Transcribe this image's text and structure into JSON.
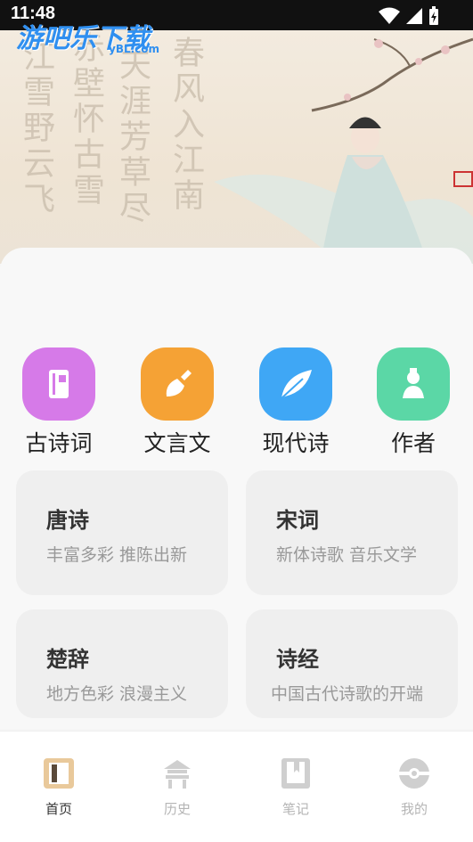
{
  "status_bar": {
    "time": "11:48"
  },
  "watermark": {
    "brand": "游吧乐下载",
    "site": "yBL.com"
  },
  "hero": {
    "callig_cols": [
      "江雪野云飞",
      "赤壁怀古雪",
      "天涯芳草尽",
      "春风入江南"
    ]
  },
  "categories": [
    {
      "label": "古诗词",
      "icon": "notebook-icon",
      "color": "#d67ae8"
    },
    {
      "label": "文言文",
      "icon": "brush-icon",
      "color": "#f5a235"
    },
    {
      "label": "现代诗",
      "icon": "feather-icon",
      "color": "#3fa7f5"
    },
    {
      "label": "作者",
      "icon": "author-icon",
      "color": "#5bd7a6"
    }
  ],
  "cards": [
    {
      "title": "唐诗",
      "sub": "丰富多彩 推陈出新"
    },
    {
      "title": "宋词",
      "sub": "新体诗歌 音乐文学"
    },
    {
      "title": "楚辞",
      "sub": "地方色彩 浪漫主义"
    },
    {
      "title": "诗经",
      "sub": "中国古代诗歌的开端"
    }
  ],
  "nav": [
    {
      "label": "首页",
      "icon": "home-book-icon",
      "active": true
    },
    {
      "label": "历史",
      "icon": "pavilion-icon",
      "active": false
    },
    {
      "label": "笔记",
      "icon": "notes-icon",
      "active": false
    },
    {
      "label": "我的",
      "icon": "profile-icon",
      "active": false
    }
  ]
}
